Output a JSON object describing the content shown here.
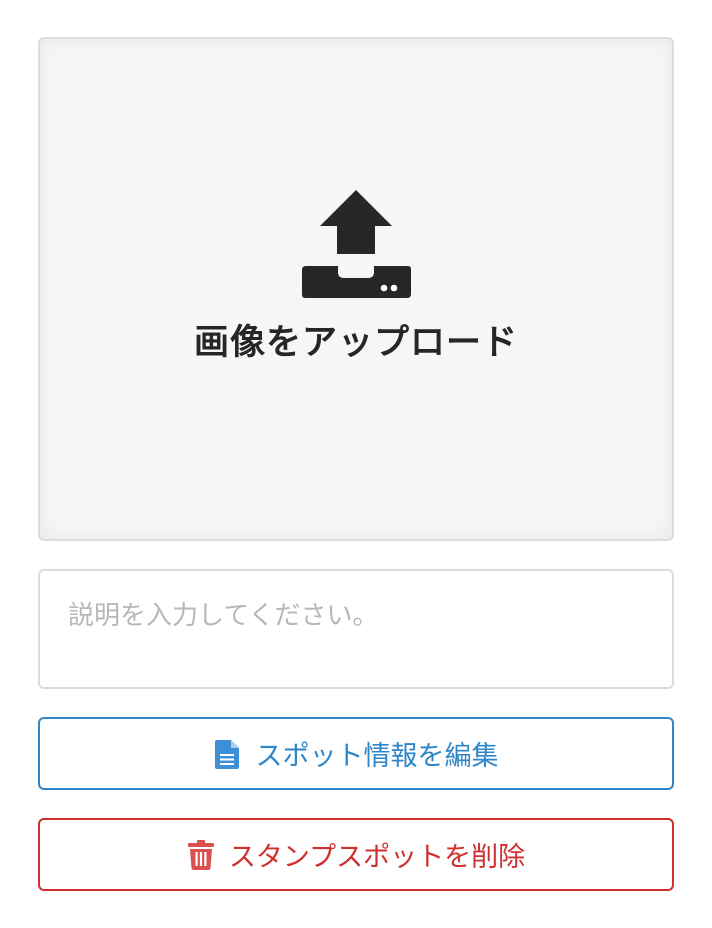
{
  "upload": {
    "label": "画像をアップロード",
    "icon": "upload-icon"
  },
  "description": {
    "placeholder": "説明を入力してください。",
    "value": ""
  },
  "buttons": {
    "edit": {
      "label": "スポット情報を編集",
      "icon": "document-icon",
      "color": "#2d86c9"
    },
    "delete": {
      "label": "スタンプスポットを削除",
      "icon": "trash-icon",
      "color": "#cf2f2f"
    }
  }
}
